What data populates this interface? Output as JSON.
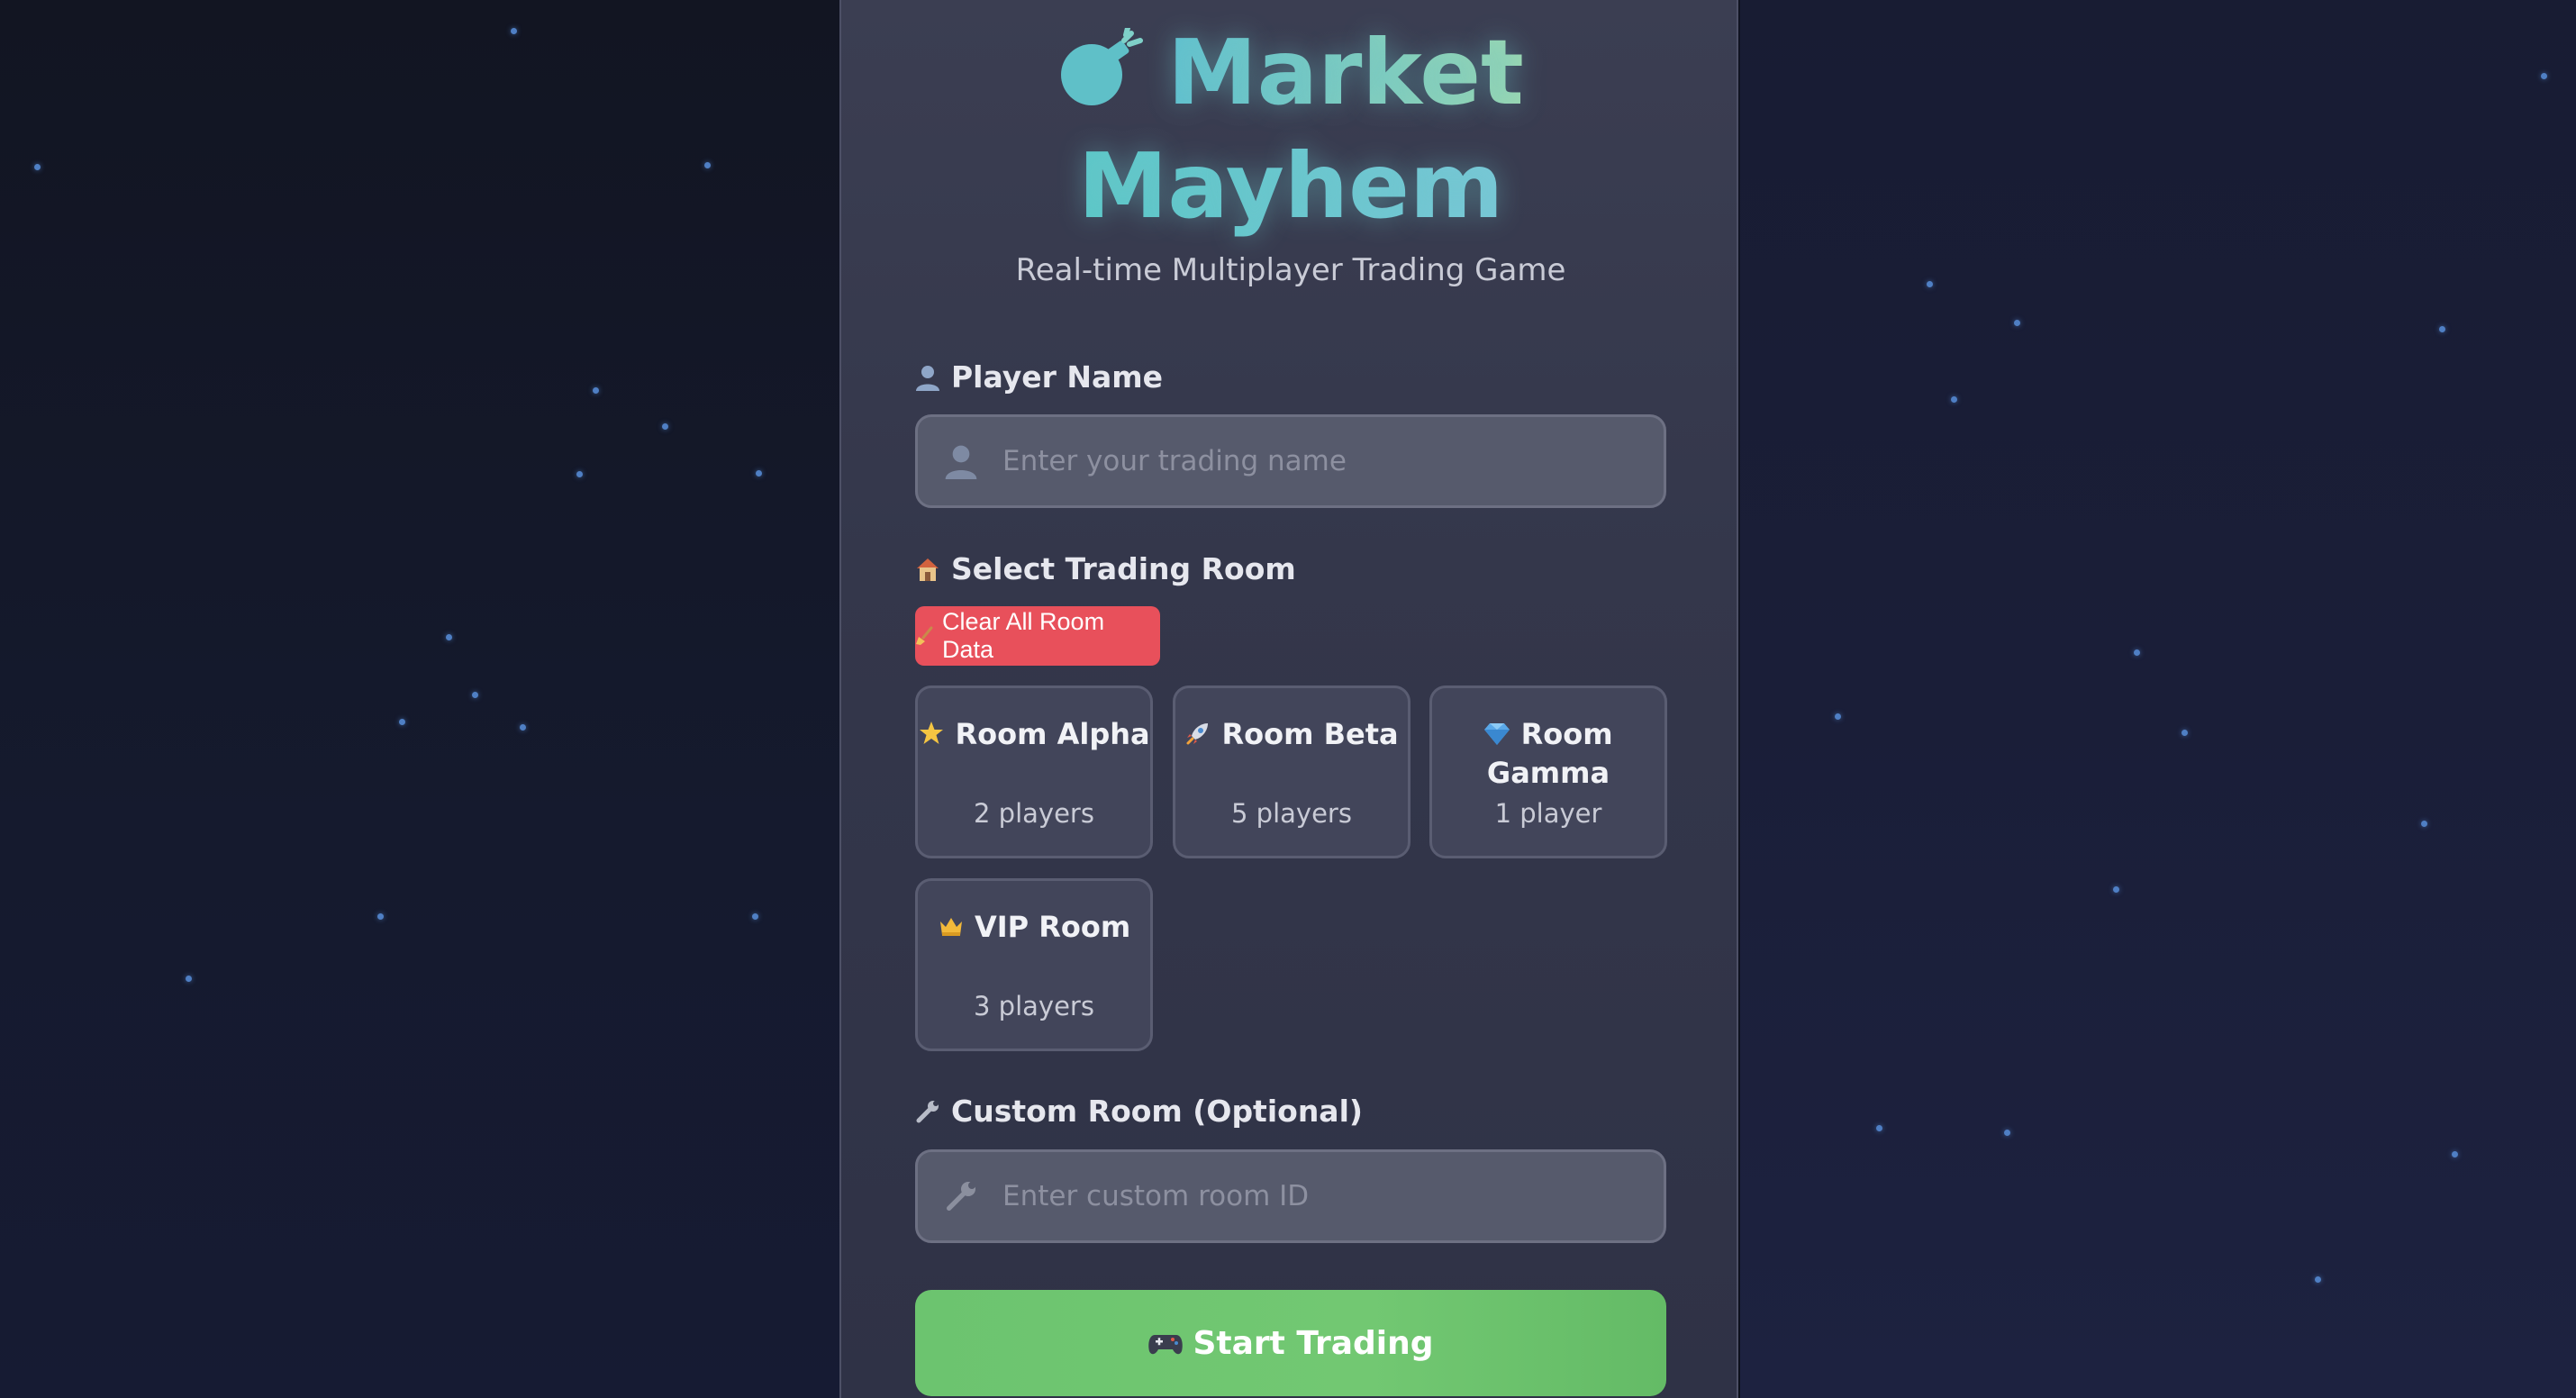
{
  "app": {
    "title_line1": "Market",
    "title_line2": "Mayhem",
    "subtitle": "Real-time Multiplayer Trading Game",
    "title_icon": "bomb-icon"
  },
  "player": {
    "label": "Player Name",
    "label_icon": "user-icon",
    "placeholder": "Enter your trading name",
    "value": ""
  },
  "rooms": {
    "label": "Select Trading Room",
    "label_icon": "house-icon",
    "clear_button": "Clear All Room Data",
    "clear_icon": "broom-icon",
    "items": [
      {
        "icon": "star-icon",
        "name": "Room Alpha",
        "players": "2 players"
      },
      {
        "icon": "rocket-icon",
        "name": "Room Beta",
        "players": "5 players"
      },
      {
        "icon": "gem-icon",
        "name": "Room Gamma",
        "players": "1 player"
      },
      {
        "icon": "crown-icon",
        "name": "VIP Room",
        "players": "3 players"
      }
    ]
  },
  "custom_room": {
    "label": "Custom Room (Optional)",
    "label_icon": "wrench-icon",
    "placeholder": "Enter custom room ID",
    "value": ""
  },
  "start": {
    "label": "Start Trading",
    "icon": "gamepad-icon"
  },
  "colors": {
    "accent_teal": "#5fc0d0",
    "danger": "#e8505b",
    "success": "#6cc46f",
    "panel": "#363a4e",
    "star": "#4f7fc4"
  }
}
